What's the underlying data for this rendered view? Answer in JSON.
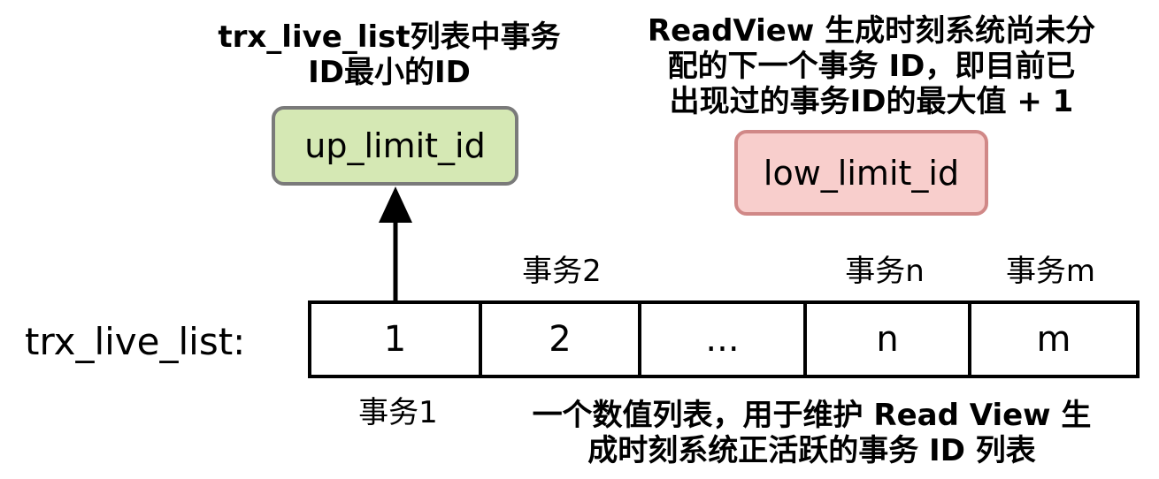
{
  "notes": {
    "up_limit": "trx_live_list列表中事务\nID最小的ID",
    "low_limit": "ReadView 生成时刻系统尚未分\n配的下一个事务 ID，即目前已\n出现过的事务ID的最大值 + 1",
    "list_desc": "一个数值列表，用于维护 Read View 生\n成时刻系统正活跃的事务 ID 列表"
  },
  "boxes": {
    "up_limit_id": "up_limit_id",
    "low_limit_id": "low_limit_id"
  },
  "list": {
    "label": "trx_live_list:",
    "cells": [
      "1",
      "2",
      "...",
      "n",
      "m"
    ],
    "tx_labels": {
      "t1": "事务1",
      "t2": "事务2",
      "tn": "事务n",
      "tm": "事务m"
    }
  },
  "colors": {
    "up_box_fill": "#d5e8b4",
    "up_box_border": "#7a7a7a",
    "low_box_fill": "#f8cecc",
    "low_box_border": "#d08887"
  }
}
